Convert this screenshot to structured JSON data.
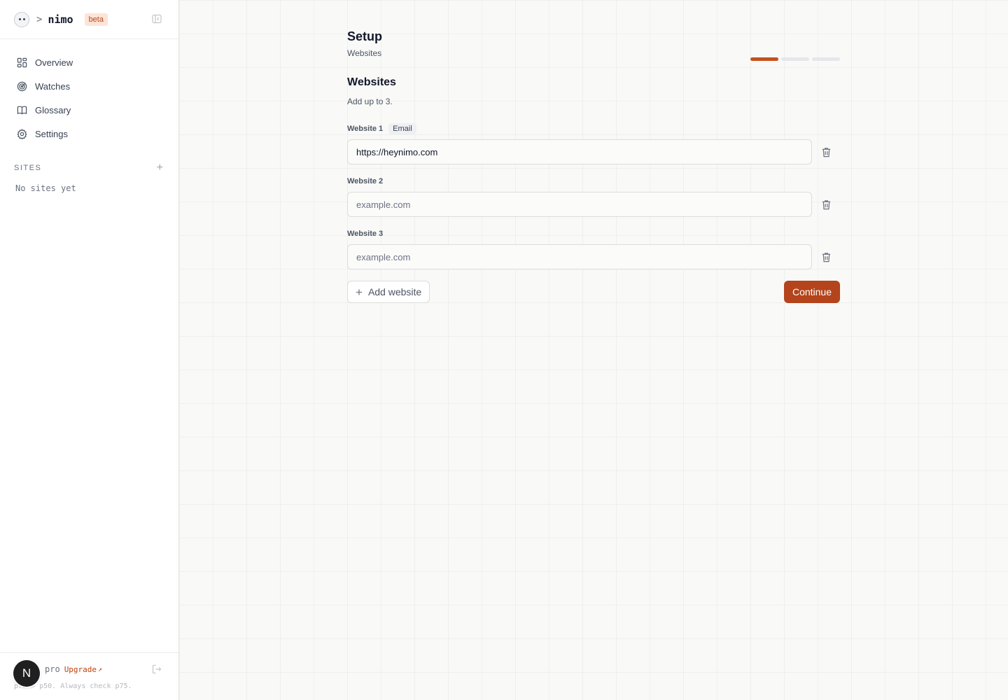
{
  "brand": {
    "prompt": ">",
    "name": "nimo",
    "badge": "beta"
  },
  "nav": {
    "items": [
      {
        "label": "Overview",
        "icon": "grid-icon"
      },
      {
        "label": "Watches",
        "icon": "radar-icon"
      },
      {
        "label": "Glossary",
        "icon": "book-icon"
      },
      {
        "label": "Settings",
        "icon": "gear-icon"
      }
    ]
  },
  "sites": {
    "title": "SITES",
    "add": "+",
    "empty": "No sites yet"
  },
  "footer": {
    "avatar": "N",
    "plan": "pro",
    "upgrade": "Upgrade",
    "upgrade_arrow": "↗",
    "hint": "p75 > p50. Always check p75."
  },
  "main": {
    "title": "Setup",
    "subtitle": "Websites",
    "progress": {
      "current_step": 1,
      "total_steps": 3
    },
    "section_title": "Websites",
    "section_subtitle": "Add up to 3.",
    "fields": [
      {
        "label": "Website 1",
        "tag": "Email",
        "value": "https://heynimo.com",
        "placeholder": "example.com"
      },
      {
        "label": "Website 2",
        "tag": "",
        "value": "",
        "placeholder": "example.com"
      },
      {
        "label": "Website 3",
        "tag": "",
        "value": "",
        "placeholder": "example.com"
      }
    ],
    "add_label": "Add website",
    "add_icon": "+",
    "continue_label": "Continue"
  },
  "colors": {
    "accent": "#b4441b",
    "progress_active": "#c4511f",
    "progress_inactive": "#e5e7eb",
    "badge_bg": "#fde4d7"
  }
}
